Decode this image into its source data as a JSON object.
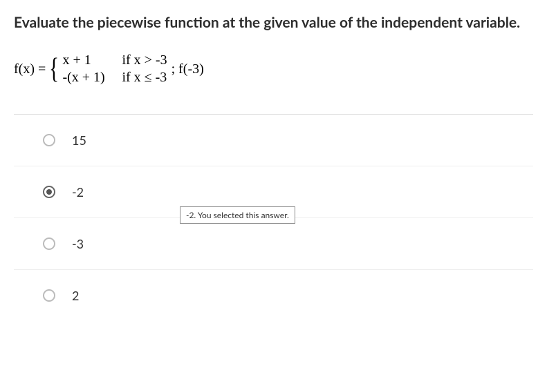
{
  "question": "Evaluate the piecewise function at the given value of the independent variable.",
  "formula": {
    "lhs": "f(x) =",
    "case1_expr": "x + 1",
    "case1_cond": "if x > -3",
    "case2_expr": "-(x + 1)",
    "case2_cond": "if x ≤ -3",
    "after": " ; f(-3)"
  },
  "options": [
    {
      "label": "15",
      "selected": false
    },
    {
      "label": "-2",
      "selected": true
    },
    {
      "label": "-3",
      "selected": false
    },
    {
      "label": "2",
      "selected": false
    }
  ],
  "tooltip": "-2. You selected this answer."
}
